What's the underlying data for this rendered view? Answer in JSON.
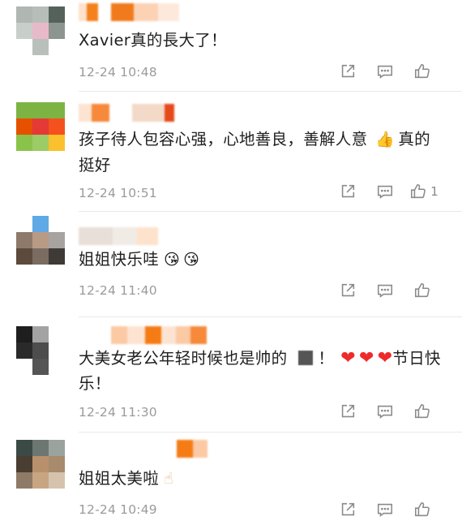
{
  "comments": [
    {
      "text": "Xavier真的長大了！",
      "time": "12-24 10:48",
      "like_count": ""
    },
    {
      "text": "孩子待人包容心强，心地善良，善解人意",
      "text_tail": "真的挺好",
      "time": "12-24 10:51",
      "like_count": "1"
    },
    {
      "text": "姐姐快乐哇",
      "time": "12-24 11:40",
      "like_count": ""
    },
    {
      "text": "大美女老公年轻时候也是帅的",
      "text_mid": "！",
      "text_tail": "节日快乐！",
      "time": "12-24 11:30",
      "like_count": ""
    },
    {
      "text": "姐姐太美啦",
      "time": "12-24 10:49",
      "like_count": ""
    }
  ],
  "icons": {
    "share": "share-icon",
    "reply": "comment-icon",
    "like": "thumbs-up-icon",
    "thumbs_emoji": "👍",
    "kiss_emoji": "😘",
    "heart": "❤",
    "point_up_emoji": "☝"
  },
  "colors": {
    "text": "#1f1f1f",
    "meta": "#9b9b9b",
    "icon": "#8a8a8a",
    "heart": "#ee2b2b",
    "accent_orange": "#f57b14"
  }
}
